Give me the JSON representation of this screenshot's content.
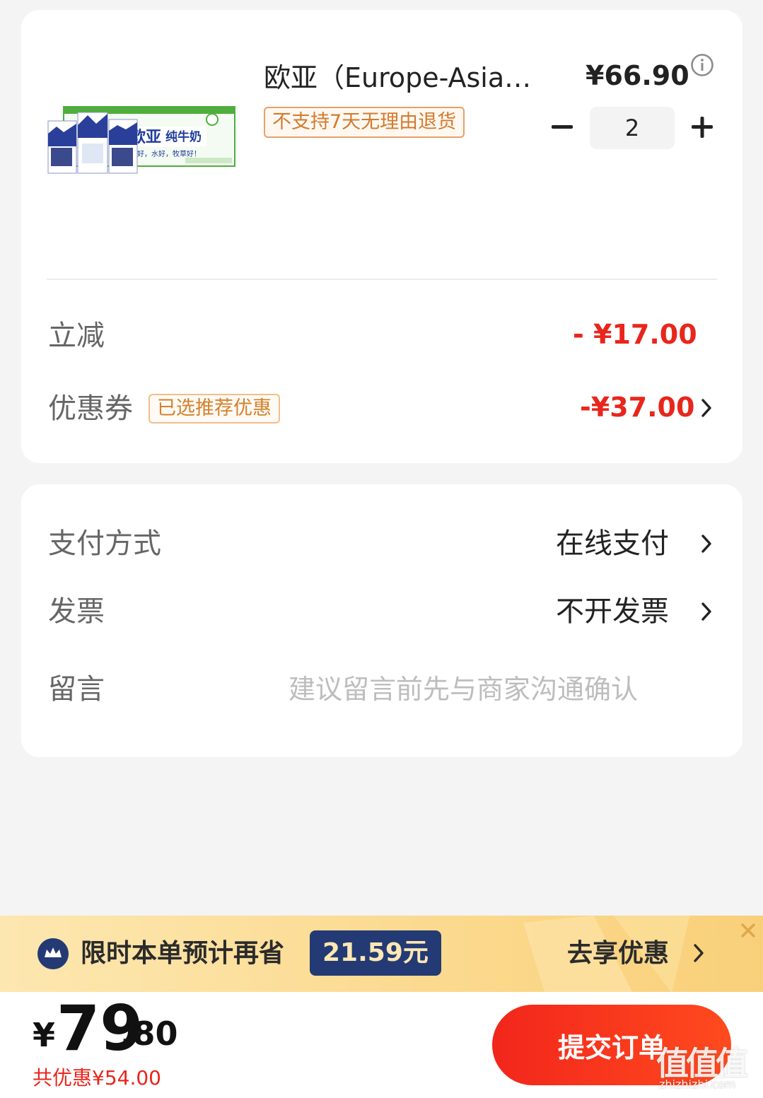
{
  "product": {
    "name": "欧亚（Europe-Asia…",
    "price": "¥66.90",
    "return_policy": "不支持7天无理由退货",
    "quantity": "2",
    "image_text_brand": "欧亚",
    "image_text_type": "纯牛奶",
    "image_text_slogan": "山好，水好，牧草好！"
  },
  "discounts": {
    "instant_label": "立减",
    "instant_value": "- ¥17.00",
    "coupon_label": "优惠券",
    "coupon_badge": "已选推荐优惠",
    "coupon_value": "-¥37.00"
  },
  "payment": {
    "method_label": "支付方式",
    "method_value": "在线支付",
    "invoice_label": "发票",
    "invoice_value": "不开发票",
    "message_label": "留言",
    "message_placeholder": "建议留言前先与商家沟通确认"
  },
  "promo": {
    "text": "限时本单预计再省",
    "amount": "21.59元",
    "cta": "去享优惠"
  },
  "footer": {
    "currency": "¥",
    "total_int": "79",
    "total_dec": ".80",
    "total_discount": "共优惠¥54.00",
    "submit_label": "提交订单"
  },
  "watermark": {
    "big": "值值值",
    "small": "zhizhizhi.com"
  },
  "colors": {
    "accent_red": "#e8261c",
    "promo_badge_bg": "#233a74",
    "badge_orange": "#d27a2c"
  }
}
